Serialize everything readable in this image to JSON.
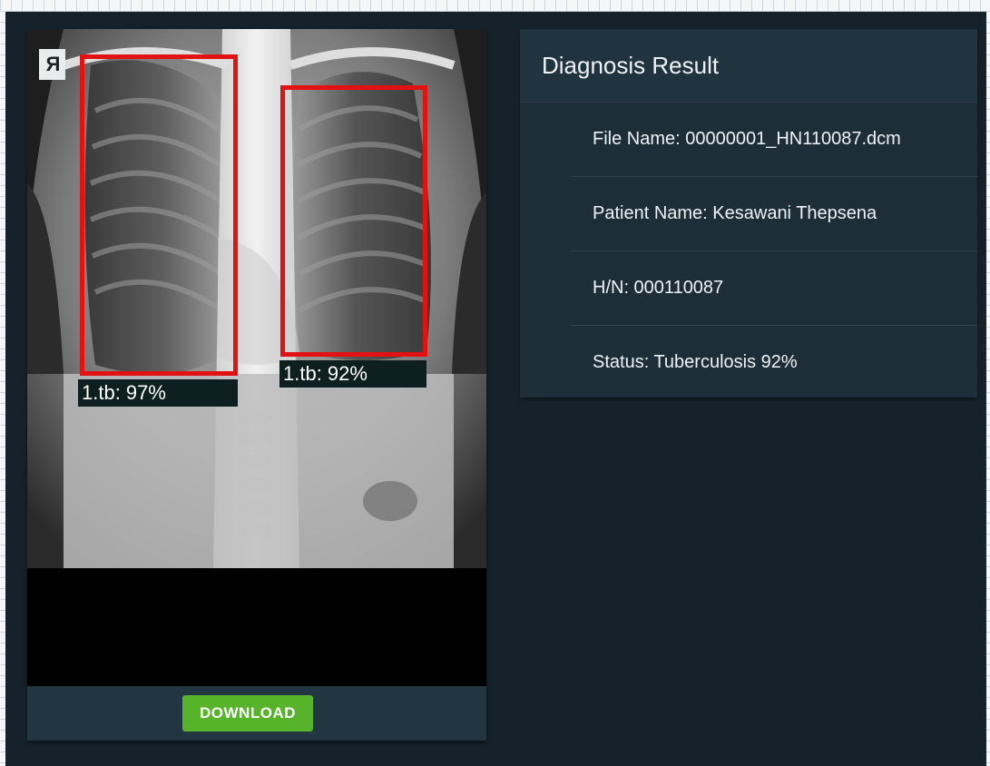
{
  "image_panel": {
    "marker": "Я",
    "detections": [
      {
        "label": "1.tb: 97%",
        "color": "#e31212"
      },
      {
        "label": "1.tb: 92%",
        "color": "#e31212"
      }
    ],
    "download_label": "DOWNLOAD",
    "download_color": "#57b42a"
  },
  "result_panel": {
    "title": "Diagnosis Result",
    "file_name": "File Name: 00000001_HN110087.dcm",
    "patient_name": "Patient Name: Kesawani Thepsena",
    "hn": "H/N: 000110087",
    "status": "Status: Tuberculosis 92%"
  }
}
